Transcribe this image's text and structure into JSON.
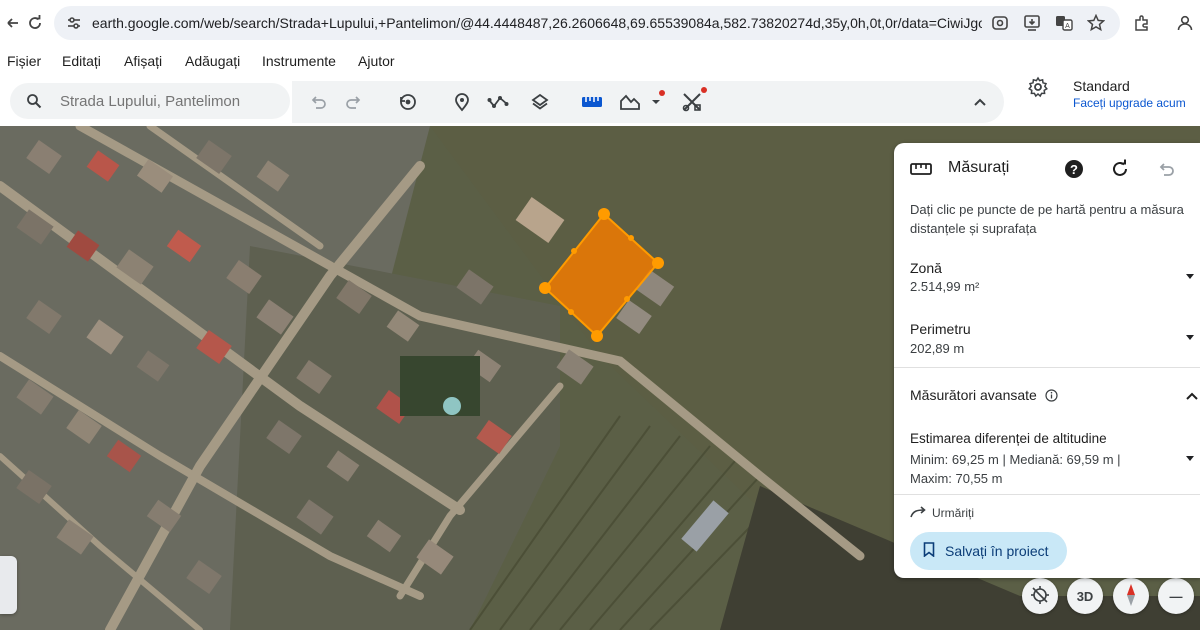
{
  "browser": {
    "url": "earth.google.com/web/search/Strada+Lupului,+Pantelimon/@44.4448487,26.2606648,69.65539084a,582.73820274d,35y,0h,0t,0r/data=CiwiJgokCXe..."
  },
  "menu": {
    "items": [
      "Fișier",
      "Editați",
      "Afișați",
      "Adăugați",
      "Instrumente",
      "Ajutor"
    ]
  },
  "search": {
    "placeholder": "Strada Lupului, Pantelimon"
  },
  "account": {
    "name": "Standard",
    "upgrade": "Faceți upgrade acum"
  },
  "measure_panel": {
    "title": "Măsurați",
    "instructions": "Dați clic pe puncte de pe hartă pentru a măsura distanțele și suprafața",
    "area_label": "Zonă",
    "area_value": "2.514,99 m²",
    "perimeter_label": "Perimetru",
    "perimeter_value": "202,89 m",
    "advanced_label": "Măsurători avansate",
    "elevation_label": "Estimarea diferenței de altitudine",
    "elevation_values": "Minim: 69,25 m | Mediană: 69,59 m | Maxim: 70,55 m",
    "follow_label": "Urmăriți",
    "save_label": "Salvați în proiect"
  },
  "map_controls": {
    "three_d_label": "3D",
    "zoom_out_label": "—"
  },
  "colors": {
    "polygon_fill": "#f07a00",
    "polygon_vertex": "#ff9b00",
    "accent_blue": "#0b57d0",
    "save_button_bg": "#c9e8f7"
  }
}
